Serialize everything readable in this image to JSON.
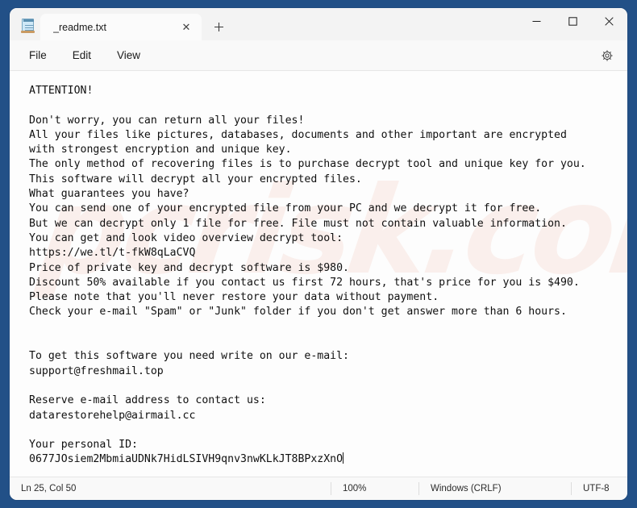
{
  "window": {
    "app_icon": "notepad-icon",
    "controls": {
      "minimize": "minimize-icon",
      "maximize": "maximize-icon",
      "close": "close-icon"
    }
  },
  "tabs": {
    "active": {
      "title": "_readme.txt",
      "close_label": "✕"
    },
    "new_tab_label": "＋"
  },
  "menubar": {
    "items": [
      {
        "label": "File"
      },
      {
        "label": "Edit"
      },
      {
        "label": "View"
      }
    ],
    "settings_icon": "gear-icon"
  },
  "editor": {
    "watermark": "pcrisk.com",
    "content": "ATTENTION!\n\nDon't worry, you can return all your files!\nAll your files like pictures, databases, documents and other important are encrypted\nwith strongest encryption and unique key.\nThe only method of recovering files is to purchase decrypt tool and unique key for you.\nThis software will decrypt all your encrypted files.\nWhat guarantees you have?\nYou can send one of your encrypted file from your PC and we decrypt it for free.\nBut we can decrypt only 1 file for free. File must not contain valuable information.\nYou can get and look video overview decrypt tool:\nhttps://we.tl/t-fkW8qLaCVQ\nPrice of private key and decrypt software is $980.\nDiscount 50% available if you contact us first 72 hours, that's price for you is $490.\nPlease note that you'll never restore your data without payment.\nCheck your e-mail \"Spam\" or \"Junk\" folder if you don't get answer more than 6 hours.\n\n\nTo get this software you need write on our e-mail:\nsupport@freshmail.top\n\nReserve e-mail address to contact us:\ndatarestorehelp@airmail.cc\n\nYour personal ID:\n0677JOsiem2MbmiaUDNk7HidLSIVH9qnv3nwKLkJT8BPxzXnO"
  },
  "statusbar": {
    "position": "Ln 25, Col 50",
    "zoom": "100%",
    "line_ending": "Windows (CRLF)",
    "encoding": "UTF-8"
  },
  "colors": {
    "desktop": "#225087",
    "chrome": "#f3f3f3",
    "editor_bg": "#fdfdfd",
    "text": "#101010",
    "watermark": "#e4785a"
  }
}
